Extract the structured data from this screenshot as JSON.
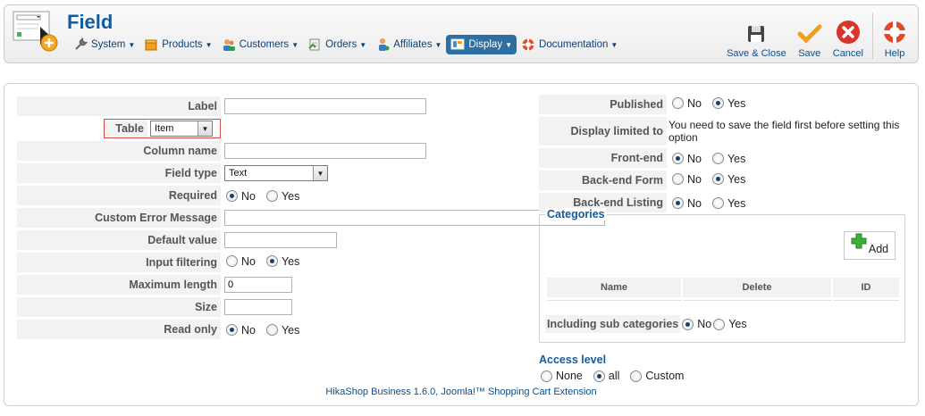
{
  "header": {
    "title": "Field",
    "menu": [
      {
        "label": "System",
        "icon": "wrench-icon"
      },
      {
        "label": "Products",
        "icon": "box-icon"
      },
      {
        "label": "Customers",
        "icon": "users-icon"
      },
      {
        "label": "Orders",
        "icon": "orders-icon"
      },
      {
        "label": "Affiliates",
        "icon": "affiliates-icon"
      },
      {
        "label": "Display",
        "icon": "display-icon",
        "active": true
      },
      {
        "label": "Documentation",
        "icon": "lifebuoy-icon"
      }
    ],
    "toolbar": {
      "save_close": "Save & Close",
      "save": "Save",
      "cancel": "Cancel",
      "help": "Help"
    }
  },
  "form_left": {
    "label": {
      "label": "Label",
      "value": ""
    },
    "table": {
      "label": "Table",
      "value": "Item"
    },
    "column_name": {
      "label": "Column name",
      "value": ""
    },
    "field_type": {
      "label": "Field type",
      "value": "Text"
    },
    "required": {
      "label": "Required",
      "options": [
        "No",
        "Yes"
      ],
      "selected": "No"
    },
    "custom_error": {
      "label": "Custom Error Message",
      "value": ""
    },
    "default_value": {
      "label": "Default value",
      "value": ""
    },
    "input_filtering": {
      "label": "Input filtering",
      "options": [
        "No",
        "Yes"
      ],
      "selected": "Yes"
    },
    "max_length": {
      "label": "Maximum length",
      "value": "0"
    },
    "size": {
      "label": "Size",
      "value": ""
    },
    "read_only": {
      "label": "Read only",
      "options": [
        "No",
        "Yes"
      ],
      "selected": "No"
    }
  },
  "form_right": {
    "published": {
      "label": "Published",
      "options": [
        "No",
        "Yes"
      ],
      "selected": "Yes"
    },
    "display_limited": {
      "label": "Display limited to",
      "message": "You need to save the field first before setting this option"
    },
    "front_end": {
      "label": "Front-end",
      "options": [
        "No",
        "Yes"
      ],
      "selected": "No"
    },
    "backend_form": {
      "label": "Back-end Form",
      "options": [
        "No",
        "Yes"
      ],
      "selected": "Yes"
    },
    "backend_listing": {
      "label": "Back-end Listing",
      "options": [
        "No",
        "Yes"
      ],
      "selected": "No"
    }
  },
  "categories": {
    "legend": "Categories",
    "add_label": "Add",
    "columns": [
      "Name",
      "Delete",
      "ID"
    ],
    "sub_label": "Including sub categories",
    "sub_options": [
      "No",
      "Yes"
    ],
    "sub_selected": "No"
  },
  "access": {
    "title": "Access level",
    "options": [
      "None",
      "all",
      "Custom"
    ],
    "selected": "all"
  },
  "footer": "HikaShop Business 1.6.0, Joomla!™ Shopping Cart Extension"
}
